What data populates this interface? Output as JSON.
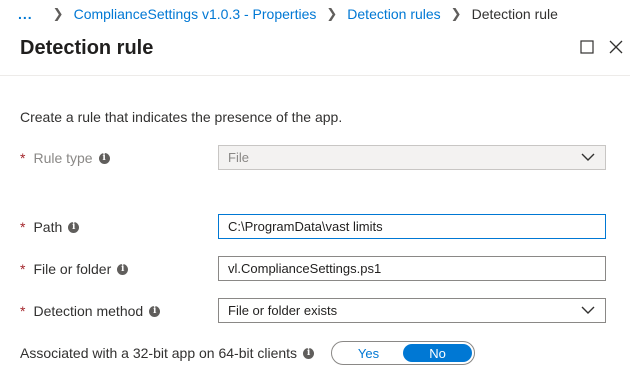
{
  "breadcrumb": {
    "ellipsis": "...",
    "items": [
      "ComplianceSettings v1.0.3 - Properties",
      "Detection rules"
    ],
    "current": "Detection rule"
  },
  "header": {
    "title": "Detection rule",
    "maximize_icon": "maximize-icon",
    "close_icon": "close-icon"
  },
  "description": "Create a rule that indicates the presence of the app.",
  "fields": {
    "rule_type": {
      "label": "Rule type",
      "value": "File",
      "disabled": true
    },
    "path": {
      "label": "Path",
      "value": "C:\\ProgramData\\vast limits"
    },
    "file_or_folder": {
      "label": "File or folder",
      "value": "vl.ComplianceSettings.ps1"
    },
    "detection_method": {
      "label": "Detection method",
      "value": "File or folder exists"
    }
  },
  "toggle": {
    "label": "Associated with a 32-bit app on 64-bit clients",
    "yes": "Yes",
    "no": "No",
    "selected": "No"
  },
  "colors": {
    "accent": "#0078d4",
    "required": "#a4262c"
  }
}
